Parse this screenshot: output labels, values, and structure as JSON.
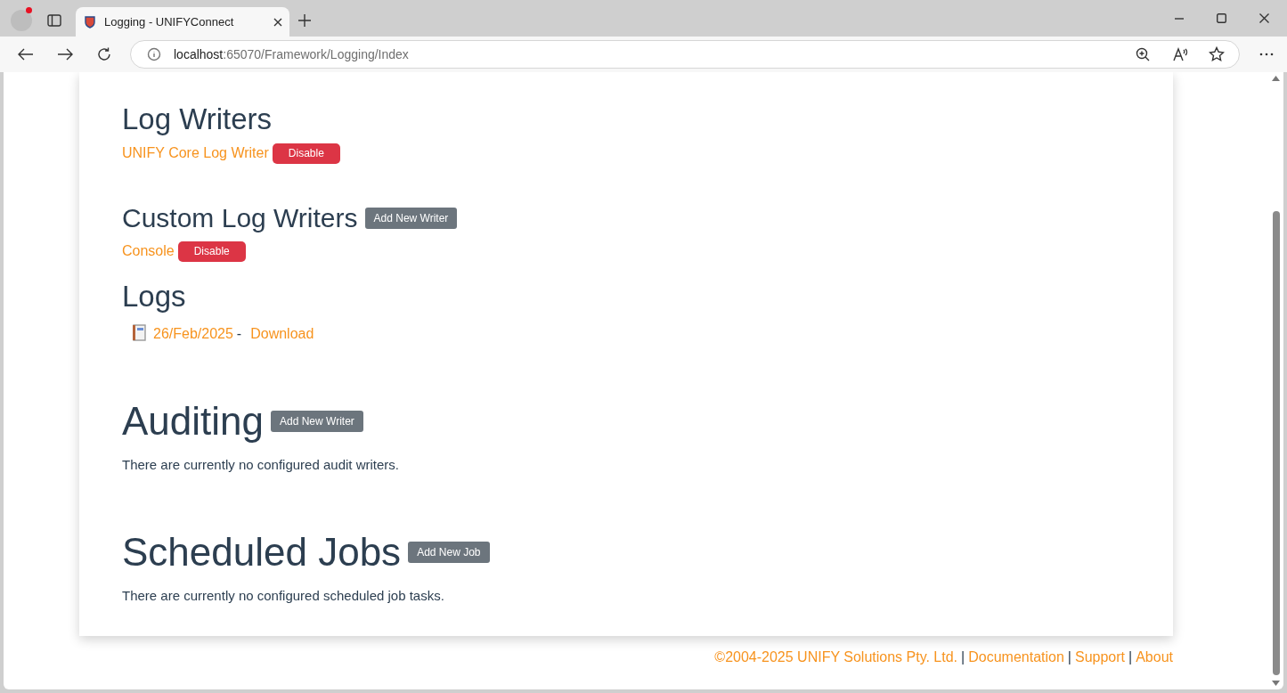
{
  "browser": {
    "tab_title": "Logging - UNIFYConnect",
    "address_host": "localhost",
    "address_rest": ":65070/Framework/Logging/Index"
  },
  "log_writers": {
    "title": "Log Writers",
    "items": [
      {
        "name": "UNIFY Core Log Writer",
        "button": "Disable"
      }
    ]
  },
  "custom_log_writers": {
    "title": "Custom Log Writers",
    "button": "Add New Writer",
    "items": [
      {
        "name": "Console",
        "button": "Disable"
      }
    ]
  },
  "logs": {
    "title": "Logs",
    "entries": [
      {
        "date": "26/Feb/2025",
        "separator": "-",
        "link": "Download"
      }
    ]
  },
  "auditing": {
    "title": "Auditing",
    "button": "Add New Writer",
    "message": "There are currently no configured audit writers."
  },
  "scheduled_jobs": {
    "title": "Scheduled Jobs",
    "button": "Add New Job",
    "message": "There are currently no configured scheduled job tasks."
  },
  "footer": {
    "copyright": "©2004-2025 UNIFY Solutions Pty. Ltd.",
    "separator": "|",
    "links": [
      "Documentation",
      "Support",
      "About"
    ]
  }
}
